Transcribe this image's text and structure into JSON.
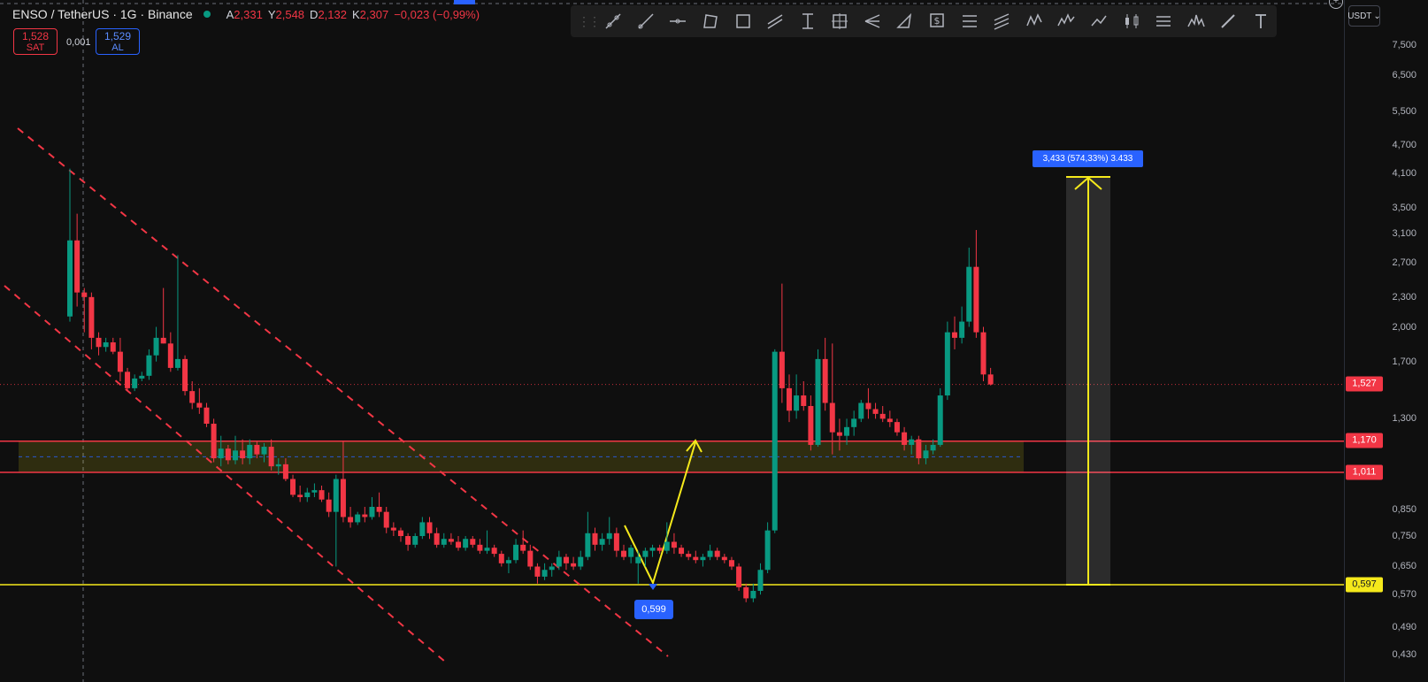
{
  "header": {
    "symbol": "ENSO / TetherUS · 1G · Binance",
    "ohlc": [
      {
        "k": "A",
        "v": "2,331"
      },
      {
        "k": "Y",
        "v": "2,548"
      },
      {
        "k": "D",
        "v": "2,132"
      },
      {
        "k": "K",
        "v": "2,307"
      },
      {
        "k": "",
        "v": "−0,023 (−0,99%)"
      }
    ]
  },
  "trade": {
    "sell_price": "1,528",
    "sell_label": "SAT",
    "spread": "0,001",
    "buy_price": "1,529",
    "buy_label": "AL"
  },
  "toolbar": {
    "tools": [
      "ray-icon",
      "trend-line-icon",
      "horizontal-ray-icon",
      "polygon-icon",
      "rectangle-icon",
      "parallel-channel-icon",
      "price-range-icon",
      "crosshair-box-icon",
      "pitchfork-icon",
      "triangle-icon",
      "price-label-icon",
      "fib-retracement-icon",
      "fib-channel-icon",
      "xabcd-pattern-icon",
      "elliott-wave-icon",
      "path-icon",
      "candlestick-icon",
      "forecast-icon",
      "head-shoulders-icon",
      "brush-icon",
      "text-icon"
    ]
  },
  "axis": {
    "currency": "USDT",
    "ticks": [
      "7,500",
      "6,500",
      "5,500",
      "4,700",
      "4,100",
      "3,500",
      "3,100",
      "2,700",
      "2,300",
      "2,000",
      "1,700",
      "1,300",
      "0,850",
      "0,750",
      "0,650",
      "0,570",
      "0,490",
      "0,430"
    ]
  },
  "tags": {
    "last": "1,527",
    "upper": "1,170",
    "lower": "1,011",
    "support": "0,597"
  },
  "annotations": {
    "measure": "3,433 (574,33%) 3.433",
    "low": "0,599"
  },
  "colors": {
    "up": "#089981",
    "down": "#f23645",
    "support": "#f5e91b",
    "zone": "#f23645",
    "accent": "#2962ff"
  },
  "chart_data": {
    "type": "candlestick",
    "symbol": "ENSO/USDT",
    "scale": "log",
    "ylim": [
      0.42,
      8.5
    ],
    "horizontal_levels": [
      1.17,
      1.011,
      0.597
    ],
    "last_price": 1.527,
    "candles": [
      [
        2.1,
        4.2,
        2.05,
        3.0
      ],
      [
        3.0,
        3.4,
        2.2,
        2.35
      ],
      [
        2.35,
        2.4,
        1.95,
        2.3
      ],
      [
        2.3,
        2.35,
        1.8,
        1.9
      ],
      [
        1.9,
        1.95,
        1.75,
        1.82
      ],
      [
        1.82,
        1.9,
        1.78,
        1.86
      ],
      [
        1.86,
        1.9,
        1.76,
        1.78
      ],
      [
        1.78,
        1.9,
        1.55,
        1.62
      ],
      [
        1.62,
        1.65,
        1.48,
        1.5
      ],
      [
        1.5,
        1.6,
        1.48,
        1.57
      ],
      [
        1.57,
        1.62,
        1.55,
        1.59
      ],
      [
        1.59,
        1.8,
        1.56,
        1.75
      ],
      [
        1.75,
        2.0,
        1.7,
        1.9
      ],
      [
        1.9,
        2.4,
        1.85,
        1.85
      ],
      [
        1.85,
        1.95,
        1.62,
        1.65
      ],
      [
        1.65,
        2.8,
        1.63,
        1.72
      ],
      [
        1.72,
        1.75,
        1.45,
        1.48
      ],
      [
        1.48,
        1.55,
        1.36,
        1.4
      ],
      [
        1.4,
        1.5,
        1.33,
        1.37
      ],
      [
        1.37,
        1.4,
        1.25,
        1.27
      ],
      [
        1.27,
        1.3,
        1.06,
        1.08
      ],
      [
        1.08,
        1.2,
        1.04,
        1.13
      ],
      [
        1.13,
        1.15,
        1.05,
        1.07
      ],
      [
        1.07,
        1.2,
        1.05,
        1.12
      ],
      [
        1.12,
        1.18,
        1.05,
        1.08
      ],
      [
        1.08,
        1.18,
        1.05,
        1.15
      ],
      [
        1.15,
        1.17,
        1.08,
        1.1
      ],
      [
        1.1,
        1.16,
        1.06,
        1.14
      ],
      [
        1.14,
        1.18,
        1.02,
        1.04
      ],
      [
        1.04,
        1.08,
        1.0,
        1.05
      ],
      [
        1.05,
        1.08,
        0.97,
        0.98
      ],
      [
        0.98,
        1.0,
        0.9,
        0.91
      ],
      [
        0.91,
        0.95,
        0.88,
        0.9
      ],
      [
        0.9,
        0.94,
        0.88,
        0.92
      ],
      [
        0.92,
        0.96,
        0.9,
        0.93
      ],
      [
        0.93,
        0.95,
        0.88,
        0.89
      ],
      [
        0.89,
        0.92,
        0.82,
        0.84
      ],
      [
        0.84,
        1.0,
        0.65,
        0.98
      ],
      [
        0.98,
        1.17,
        0.8,
        0.82
      ],
      [
        0.82,
        0.86,
        0.78,
        0.8
      ],
      [
        0.8,
        0.84,
        0.79,
        0.83
      ],
      [
        0.83,
        0.86,
        0.8,
        0.82
      ],
      [
        0.82,
        0.9,
        0.81,
        0.86
      ],
      [
        0.86,
        0.92,
        0.82,
        0.84
      ],
      [
        0.84,
        0.86,
        0.76,
        0.78
      ],
      [
        0.78,
        0.8,
        0.75,
        0.77
      ],
      [
        0.77,
        0.78,
        0.73,
        0.75
      ],
      [
        0.75,
        0.76,
        0.7,
        0.72
      ],
      [
        0.72,
        0.76,
        0.71,
        0.75
      ],
      [
        0.75,
        0.82,
        0.74,
        0.8
      ],
      [
        0.8,
        0.82,
        0.74,
        0.76
      ],
      [
        0.76,
        0.78,
        0.71,
        0.72
      ],
      [
        0.72,
        0.76,
        0.71,
        0.74
      ],
      [
        0.74,
        0.76,
        0.72,
        0.73
      ],
      [
        0.73,
        0.75,
        0.7,
        0.71
      ],
      [
        0.71,
        0.75,
        0.7,
        0.74
      ],
      [
        0.74,
        0.75,
        0.71,
        0.72
      ],
      [
        0.72,
        0.74,
        0.69,
        0.7
      ],
      [
        0.7,
        0.77,
        0.69,
        0.71
      ],
      [
        0.71,
        0.72,
        0.68,
        0.69
      ],
      [
        0.69,
        0.7,
        0.65,
        0.66
      ],
      [
        0.66,
        0.68,
        0.63,
        0.67
      ],
      [
        0.67,
        0.74,
        0.66,
        0.72
      ],
      [
        0.72,
        0.77,
        0.69,
        0.7
      ],
      [
        0.7,
        0.72,
        0.64,
        0.65
      ],
      [
        0.65,
        0.66,
        0.6,
        0.62
      ],
      [
        0.62,
        0.66,
        0.61,
        0.64
      ],
      [
        0.64,
        0.66,
        0.62,
        0.65
      ],
      [
        0.65,
        0.7,
        0.64,
        0.68
      ],
      [
        0.68,
        0.69,
        0.64,
        0.66
      ],
      [
        0.66,
        0.68,
        0.64,
        0.65
      ],
      [
        0.65,
        0.7,
        0.64,
        0.68
      ],
      [
        0.68,
        0.84,
        0.67,
        0.76
      ],
      [
        0.76,
        0.78,
        0.7,
        0.72
      ],
      [
        0.72,
        0.76,
        0.7,
        0.74
      ],
      [
        0.74,
        0.82,
        0.72,
        0.76
      ],
      [
        0.76,
        0.78,
        0.68,
        0.7
      ],
      [
        0.7,
        0.72,
        0.67,
        0.68
      ],
      [
        0.68,
        0.72,
        0.66,
        0.71
      ],
      [
        0.66,
        0.7,
        0.6,
        0.68
      ],
      [
        0.68,
        0.71,
        0.65,
        0.7
      ],
      [
        0.7,
        0.72,
        0.68,
        0.71
      ],
      [
        0.71,
        0.72,
        0.69,
        0.7
      ],
      [
        0.7,
        0.8,
        0.69,
        0.73
      ],
      [
        0.73,
        0.76,
        0.69,
        0.71
      ],
      [
        0.71,
        0.72,
        0.68,
        0.69
      ],
      [
        0.69,
        0.7,
        0.67,
        0.68
      ],
      [
        0.68,
        0.7,
        0.66,
        0.67
      ],
      [
        0.67,
        0.69,
        0.65,
        0.68
      ],
      [
        0.68,
        0.72,
        0.67,
        0.7
      ],
      [
        0.7,
        0.71,
        0.67,
        0.68
      ],
      [
        0.68,
        0.69,
        0.66,
        0.67
      ],
      [
        0.67,
        0.68,
        0.64,
        0.65
      ],
      [
        0.65,
        0.66,
        0.58,
        0.59
      ],
      [
        0.59,
        0.6,
        0.55,
        0.56
      ],
      [
        0.56,
        0.6,
        0.55,
        0.58
      ],
      [
        0.58,
        0.66,
        0.57,
        0.64
      ],
      [
        0.64,
        0.8,
        0.63,
        0.77
      ],
      [
        0.77,
        1.8,
        0.76,
        1.78
      ],
      [
        1.78,
        2.45,
        1.4,
        1.5
      ],
      [
        1.5,
        1.6,
        1.28,
        1.35
      ],
      [
        1.35,
        1.6,
        1.3,
        1.45
      ],
      [
        1.45,
        1.55,
        1.35,
        1.38
      ],
      [
        1.38,
        1.45,
        1.12,
        1.15
      ],
      [
        1.15,
        1.8,
        1.14,
        1.72
      ],
      [
        1.72,
        1.9,
        1.35,
        1.4
      ],
      [
        1.4,
        1.85,
        1.1,
        1.22
      ],
      [
        1.22,
        1.3,
        1.12,
        1.2
      ],
      [
        1.2,
        1.3,
        1.15,
        1.25
      ],
      [
        1.25,
        1.35,
        1.2,
        1.3
      ],
      [
        1.3,
        1.42,
        1.28,
        1.4
      ],
      [
        1.4,
        1.5,
        1.3,
        1.36
      ],
      [
        1.36,
        1.4,
        1.3,
        1.33
      ],
      [
        1.33,
        1.38,
        1.28,
        1.3
      ],
      [
        1.3,
        1.35,
        1.25,
        1.28
      ],
      [
        1.28,
        1.3,
        1.2,
        1.22
      ],
      [
        1.22,
        1.25,
        1.12,
        1.15
      ],
      [
        1.15,
        1.2,
        1.1,
        1.18
      ],
      [
        1.18,
        1.2,
        1.05,
        1.08
      ],
      [
        1.08,
        1.15,
        1.05,
        1.12
      ],
      [
        1.12,
        1.18,
        1.1,
        1.15
      ],
      [
        1.15,
        1.5,
        1.14,
        1.45
      ],
      [
        1.45,
        2.05,
        1.42,
        1.95
      ],
      [
        1.95,
        2.1,
        1.8,
        1.9
      ],
      [
        1.9,
        2.2,
        1.85,
        2.05
      ],
      [
        2.05,
        2.9,
        2.0,
        2.65
      ],
      [
        2.65,
        3.15,
        1.9,
        1.95
      ],
      [
        1.95,
        2.0,
        1.55,
        1.6
      ],
      [
        1.6,
        1.65,
        1.52,
        1.527
      ]
    ]
  }
}
